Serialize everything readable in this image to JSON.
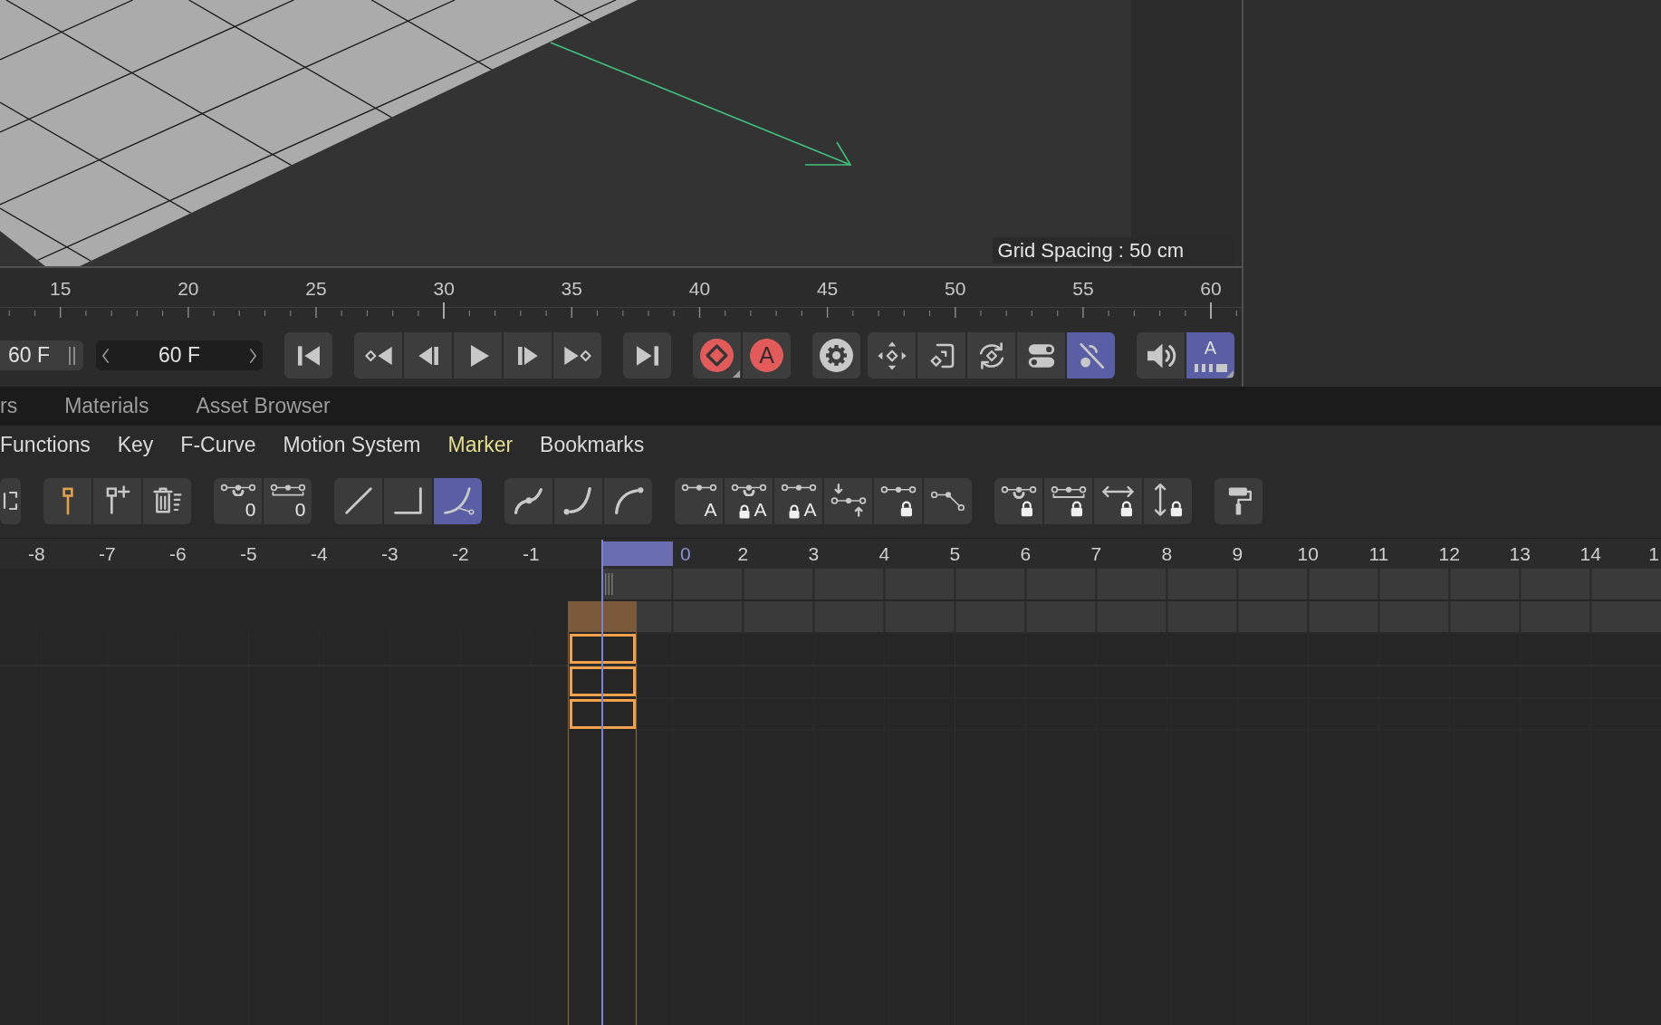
{
  "viewport": {
    "grid_spacing": "Grid Spacing : 50 cm"
  },
  "frame_ruler": {
    "labels": [
      "15",
      "20",
      "25",
      "30",
      "35",
      "40",
      "45",
      "50",
      "55",
      "60"
    ],
    "playhead": {
      "level": 0.3576
    }
  },
  "transport": {
    "frame_field": {
      "value": "60 F"
    },
    "end_field": {
      "value": "60 F"
    },
    "groups": [
      {
        "buttons": [
          {
            "kind": "start"
          }
        ]
      },
      {
        "buttons": [
          {
            "kind": "prevkey"
          },
          {
            "kind": "prevframe"
          },
          {
            "kind": "play"
          },
          {
            "kind": "nextframe"
          },
          {
            "kind": "nextkey"
          }
        ]
      },
      {
        "buttons": [
          {
            "kind": "end"
          }
        ]
      },
      {
        "buttons": [
          {
            "kind": "record",
            "menu": true
          },
          {
            "kind": "autokey",
            "label": "A",
            "menu": false
          }
        ]
      },
      {
        "buttons": [
          {
            "kind": "settings"
          }
        ]
      },
      {
        "buttons": [
          {
            "kind": "move",
            "on": false
          },
          {
            "kind": "scale",
            "on": false
          },
          {
            "kind": "rotate",
            "on": false
          },
          {
            "kind": "params",
            "on": false
          },
          {
            "kind": "pla",
            "on": true
          }
        ]
      },
      {
        "buttons": [
          {
            "kind": "sound",
            "on": false,
            "menu": false
          },
          {
            "kind": "audio",
            "label": "A",
            "on": true,
            "menu": true
          }
        ]
      }
    ]
  },
  "panel_tabs": [
    {
      "label": "rs"
    },
    {
      "label": "Materials"
    },
    {
      "label": "Asset Browser"
    }
  ],
  "menu": [
    {
      "label": "Functions",
      "highlighted": false
    },
    {
      "label": "Key",
      "highlighted": false
    },
    {
      "label": "F-Curve",
      "highlighted": false
    },
    {
      "label": "Motion System",
      "highlighted": false
    },
    {
      "label": "Marker",
      "highlighted": true
    },
    {
      "label": "Bookmarks",
      "highlighted": false
    }
  ],
  "toolbar": {
    "groups": [
      {
        "buttons": [
          {
            "kind": "frame"
          }
        ]
      },
      {
        "buttons": [
          {
            "kind": "keypin"
          },
          {
            "kind": "addkey"
          },
          {
            "kind": "deletekey"
          }
        ]
      },
      {
        "buttons": [
          {
            "kind": "zeroangle",
            "label": "0"
          },
          {
            "kind": "zerolength",
            "label": "0"
          }
        ]
      },
      {
        "buttons": [
          {
            "kind": "linear",
            "selected": false
          },
          {
            "kind": "step",
            "selected": false
          },
          {
            "kind": "spline",
            "selected": true
          }
        ]
      },
      {
        "buttons": [
          {
            "kind": "easeboth"
          },
          {
            "kind": "easein"
          },
          {
            "kind": "easeout"
          }
        ]
      },
      {
        "buttons": [
          {
            "kind": "autotangent",
            "label": "A"
          },
          {
            "kind": "lockedangle",
            "label": "A"
          },
          {
            "kind": "lockedauto",
            "label": "A"
          },
          {
            "kind": "flatten"
          },
          {
            "kind": "lockedkey"
          },
          {
            "kind": "breaktangent"
          }
        ]
      },
      {
        "buttons": [
          {
            "kind": "lockangle"
          },
          {
            "kind": "locklength"
          },
          {
            "kind": "lockx"
          },
          {
            "kind": "locky"
          }
        ]
      },
      {
        "buttons": [
          {
            "kind": "paint"
          }
        ]
      }
    ]
  },
  "dope_sheet": {
    "ruler": {
      "labels_before": [
        "-8",
        "-7",
        "-6",
        "-5",
        "-4",
        "-3",
        "-2",
        "-1"
      ],
      "current": "0",
      "labels_after": [
        "2",
        "3",
        "4",
        "5",
        "6",
        "7",
        "8",
        "9",
        "10",
        "11",
        "12",
        "13",
        "14",
        "1"
      ]
    },
    "keys": [
      {
        "selected": true
      },
      {
        "selected": true
      },
      {
        "selected": true
      }
    ]
  }
}
